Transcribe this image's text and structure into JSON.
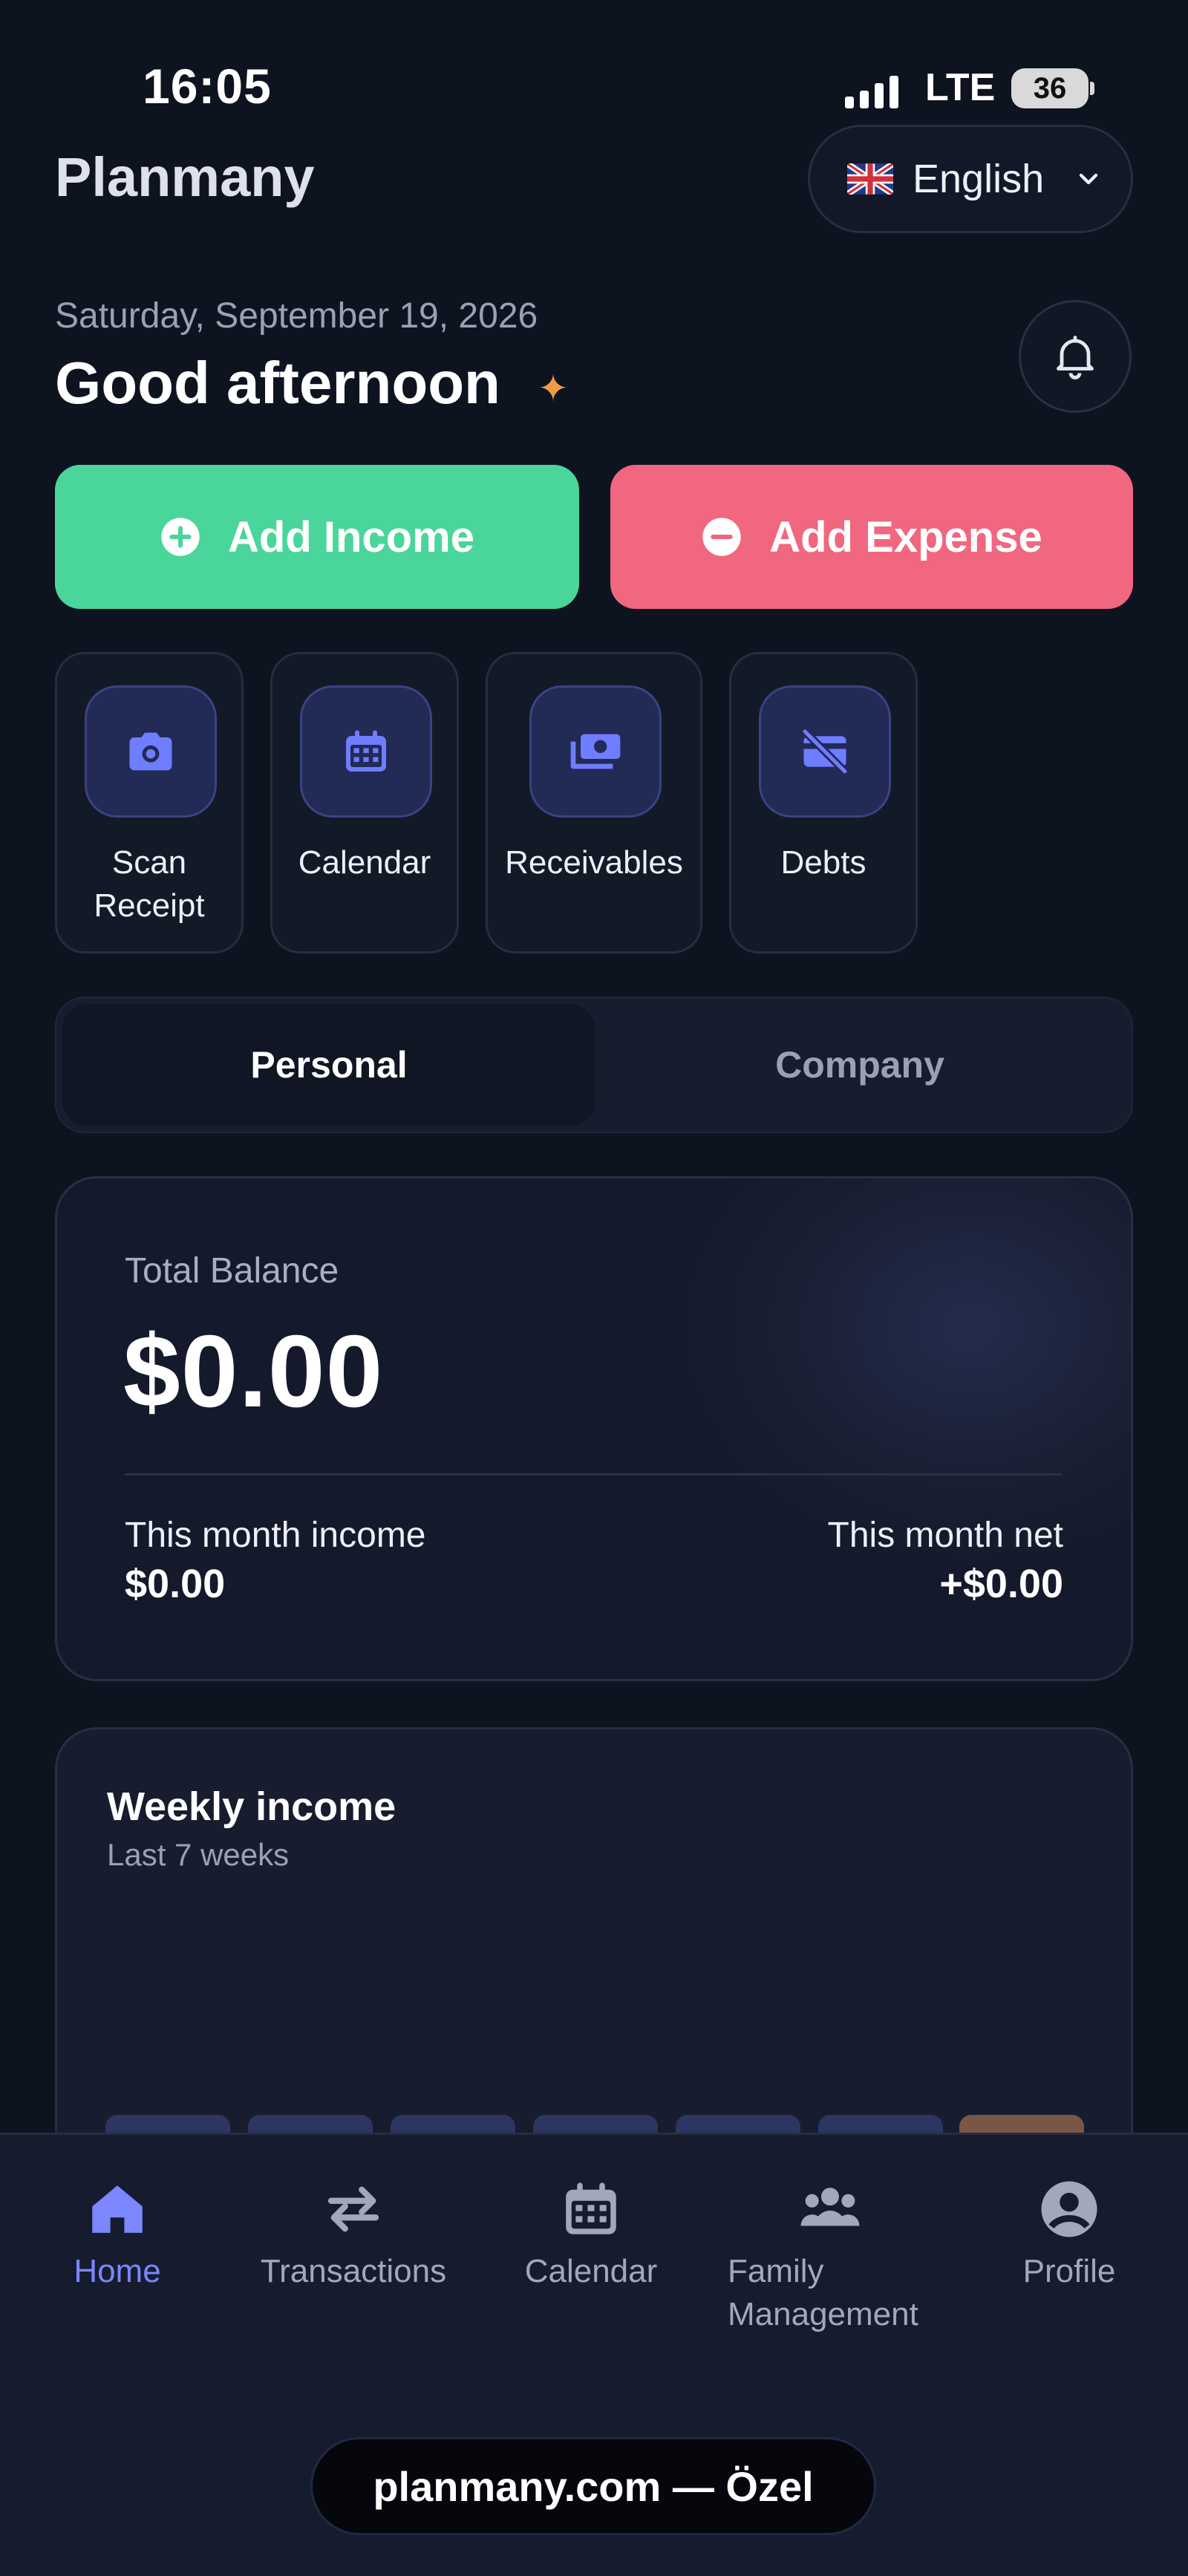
{
  "status_bar": {
    "time": "16:05",
    "network": "LTE",
    "battery": "36"
  },
  "header": {
    "brand": "Planmany",
    "language": {
      "label": "English",
      "flag_icon": "uk-flag-icon"
    }
  },
  "greeting": {
    "date": "Saturday, September 19, 2026",
    "text": "Good afternoon",
    "spark": "✦"
  },
  "actions": {
    "add_income": "Add Income",
    "add_expense": "Add Expense"
  },
  "quick_tiles": [
    {
      "label_line1": "Scan",
      "label_line2": "Receipt",
      "icon": "camera-icon"
    },
    {
      "label_line1": "Calendar",
      "label_line2": "",
      "icon": "calendar-icon"
    },
    {
      "label_line1": "Receivables",
      "label_line2": "",
      "icon": "money-icon"
    },
    {
      "label_line1": "Debts",
      "label_line2": "",
      "icon": "card-off-icon"
    }
  ],
  "segment": {
    "personal": "Personal",
    "company": "Company",
    "selected": "Personal"
  },
  "balance": {
    "title": "Total Balance",
    "amount": "$0.00",
    "income_label": "This month income",
    "income_value": "$0.00",
    "net_label": "This month net",
    "net_value": "+$0.00"
  },
  "weekly": {
    "title": "Weekly income",
    "subtitle": "Last 7 weeks"
  },
  "nav": [
    {
      "label": "Home",
      "icon": "home-icon",
      "active": true
    },
    {
      "label": "Transactions",
      "icon": "swap-arrows-icon",
      "active": false
    },
    {
      "label": "Calendar",
      "icon": "calendar-icon",
      "active": false
    },
    {
      "label_line1": "Family",
      "label_line2": "Management",
      "icon": "group-icon",
      "active": false
    },
    {
      "label": "Profile",
      "icon": "profile-icon",
      "active": false
    }
  ],
  "footer": {
    "url": "planmany.com — Özel"
  },
  "colors": {
    "background": "#0e1320",
    "income_green": "#4ad69a",
    "expense_red": "#f0677f",
    "accent": "#7b86ff",
    "tile_icon_bg": "#222a56"
  }
}
